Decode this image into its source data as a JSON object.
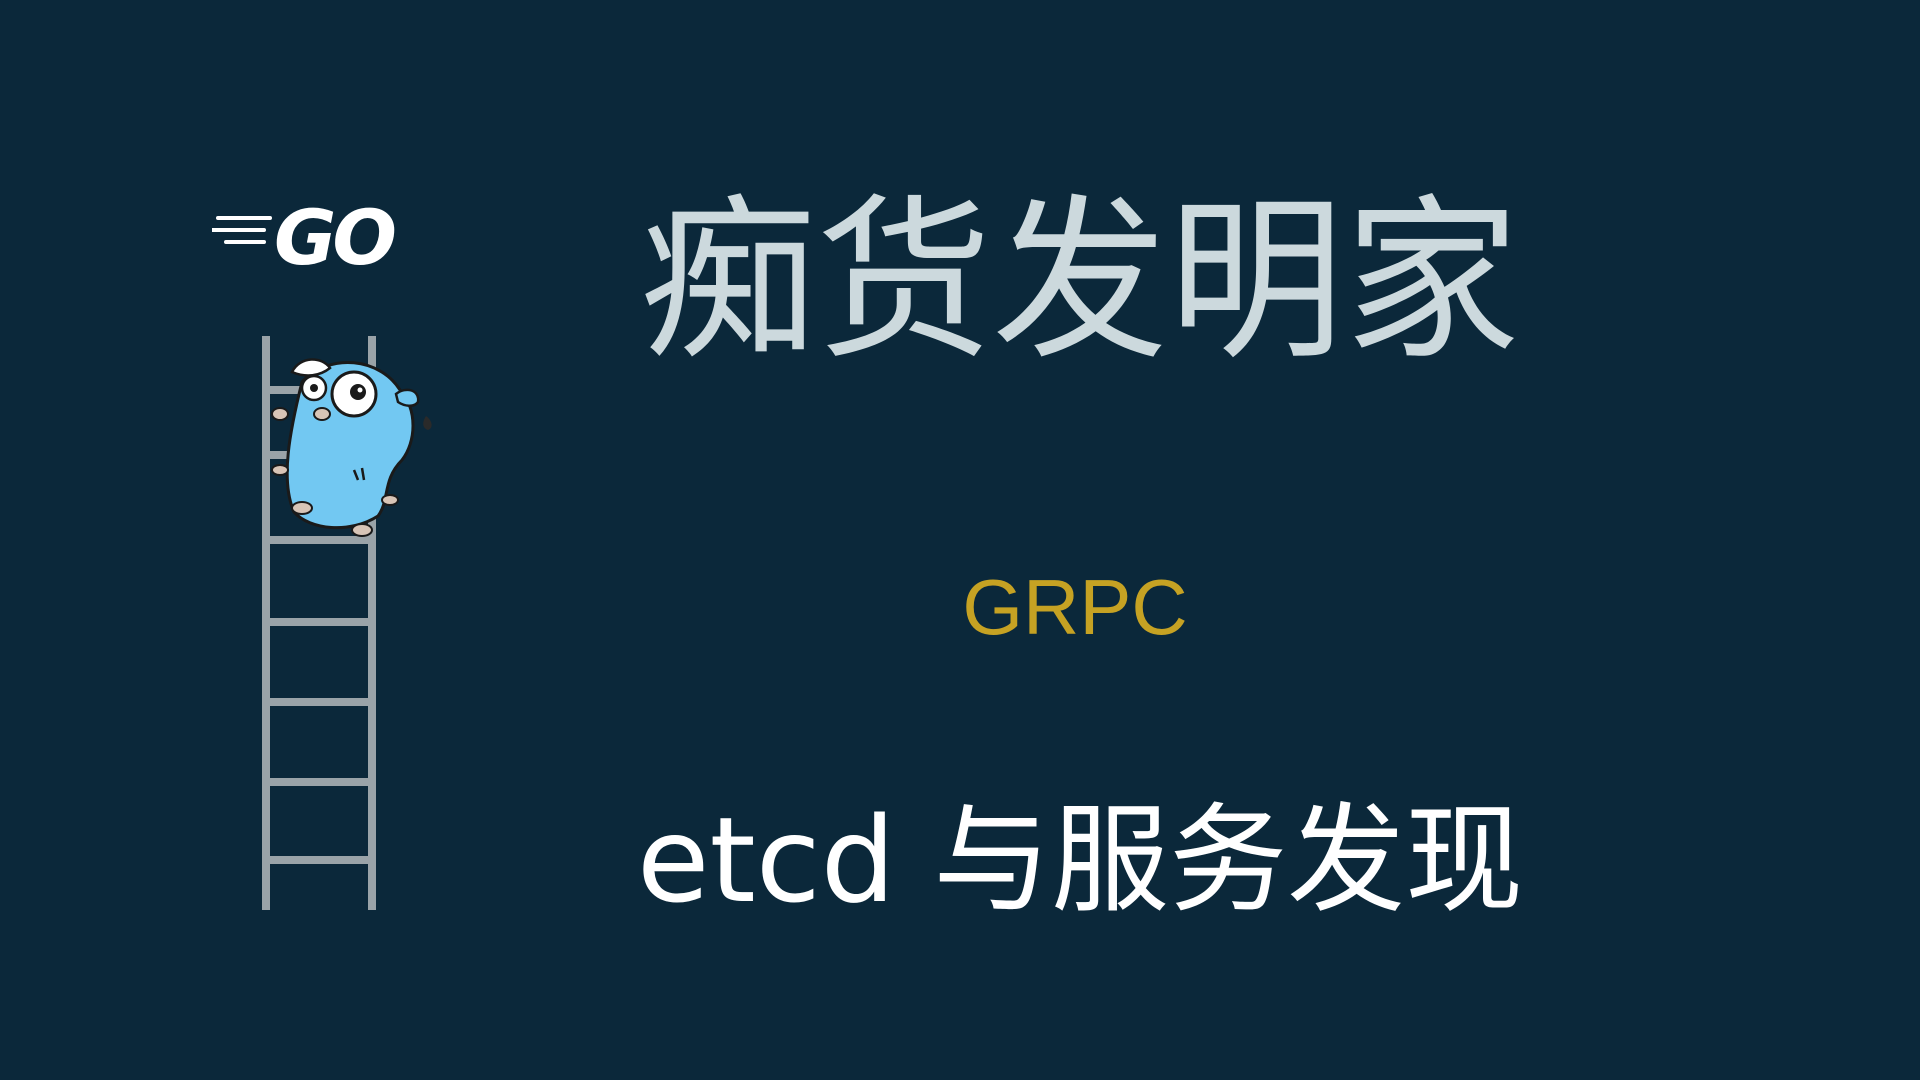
{
  "slide": {
    "title": "痴货发明家",
    "subtitle": "GRPC",
    "topic": "etcd 与服务发现"
  },
  "logo": {
    "text": "GO",
    "icon": "go-logo-icon"
  },
  "illustration": {
    "icon": "gopher-climbing-ladder-icon"
  },
  "colors": {
    "background": "#0b283a",
    "title": "#ccd9dd",
    "subtitle": "#c6a223",
    "topic": "#ffffff",
    "gopher": "#72c8f2",
    "ladder": "#9aa3a8"
  }
}
